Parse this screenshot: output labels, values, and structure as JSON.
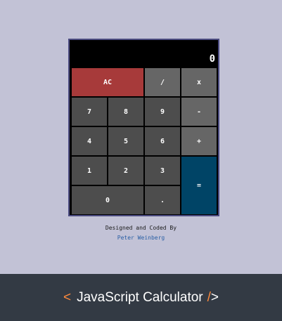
{
  "calculator": {
    "formula": "",
    "current": "0",
    "buttons": {
      "clear": "AC",
      "divide": "/",
      "multiply": "x",
      "seven": "7",
      "eight": "8",
      "nine": "9",
      "subtract": "-",
      "four": "4",
      "five": "5",
      "six": "6",
      "add": "+",
      "one": "1",
      "two": "2",
      "three": "3",
      "equals": "=",
      "zero": "0",
      "decimal": "."
    }
  },
  "credit": {
    "line1": "Designed and Coded By",
    "author": "Peter Weinberg"
  },
  "footer": {
    "open": "<",
    "title": "JavaScript Calculator",
    "slash": "/",
    "close": ">"
  },
  "colors": {
    "background": "#c2c2d6",
    "clear": "#a73a3a",
    "equals": "#004466",
    "footer": "#333a44",
    "accent": "#ff8a3d"
  }
}
